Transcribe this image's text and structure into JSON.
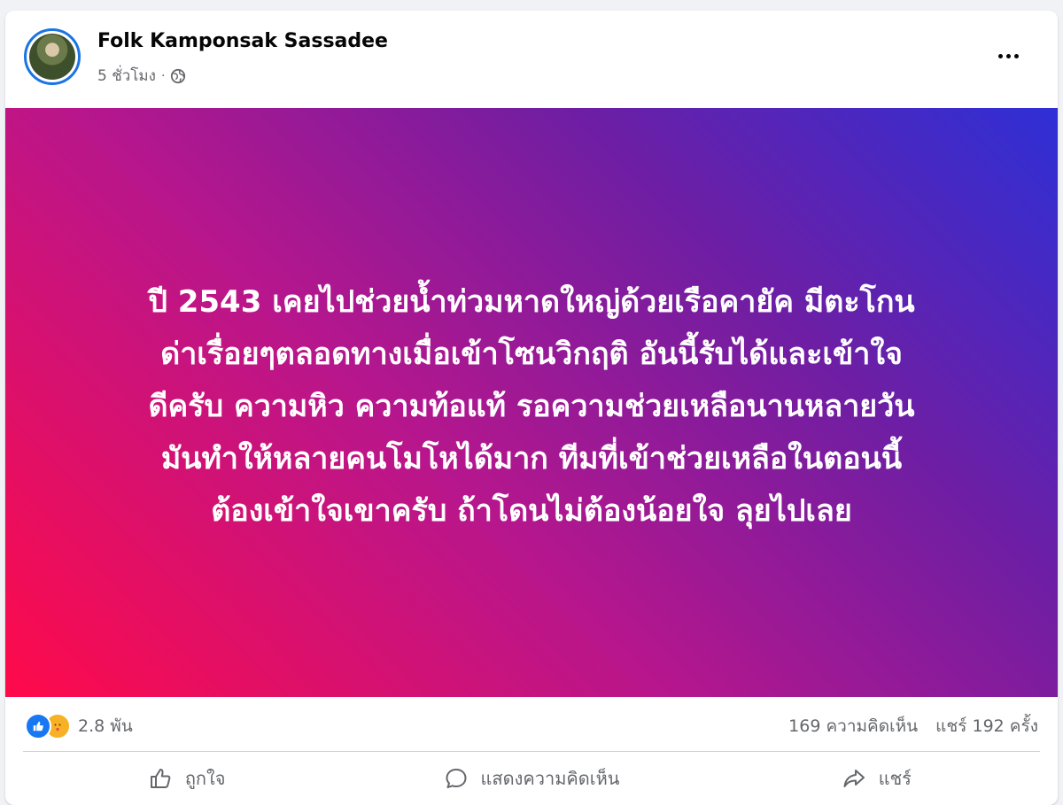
{
  "post": {
    "author": "Folk Kamponsak Sassadee",
    "time": "5 ชั่วโมง",
    "privacy_icon": "globe-icon",
    "more_icon": "more-options-icon",
    "background_gradient": [
      "#ff0a4a",
      "#b8168c",
      "#6f1ea3",
      "#2e2fd6"
    ],
    "text_lines": [
      "ปี 2543 เคยไปช่วยน้ำท่วมหาดใหญ่ด้วยเรือคายัค มีตะโกน",
      "ด่าเรื่อยๆตลอดทางเมื่อเข้าโซนวิกฤติ อันนี้รับได้และเข้าใจ",
      "ดีครับ ความหิว ความท้อแท้ รอความช่วยเหลือนานหลายวัน",
      "มันทำให้หลายคนโมโหได้มาก ทีมที่เข้าช่วยเหลือในตอนนี้",
      "ต้องเข้าใจเขาครับ ถ้าโดนไม่ต้องน้อยใจ ลุยไปเลย"
    ]
  },
  "reactions": {
    "count": "2.8 พัน",
    "icons": [
      "like-icon",
      "care-icon"
    ]
  },
  "stats": {
    "comments": "169 ความคิดเห็น",
    "shares": "แชร์ 192 ครั้ง"
  },
  "actions": {
    "like": "ถูกใจ",
    "comment": "แสดงความคิดเห็น",
    "share": "แชร์"
  },
  "colors": {
    "accent": "#1877f2",
    "muted_text": "#65676b"
  }
}
